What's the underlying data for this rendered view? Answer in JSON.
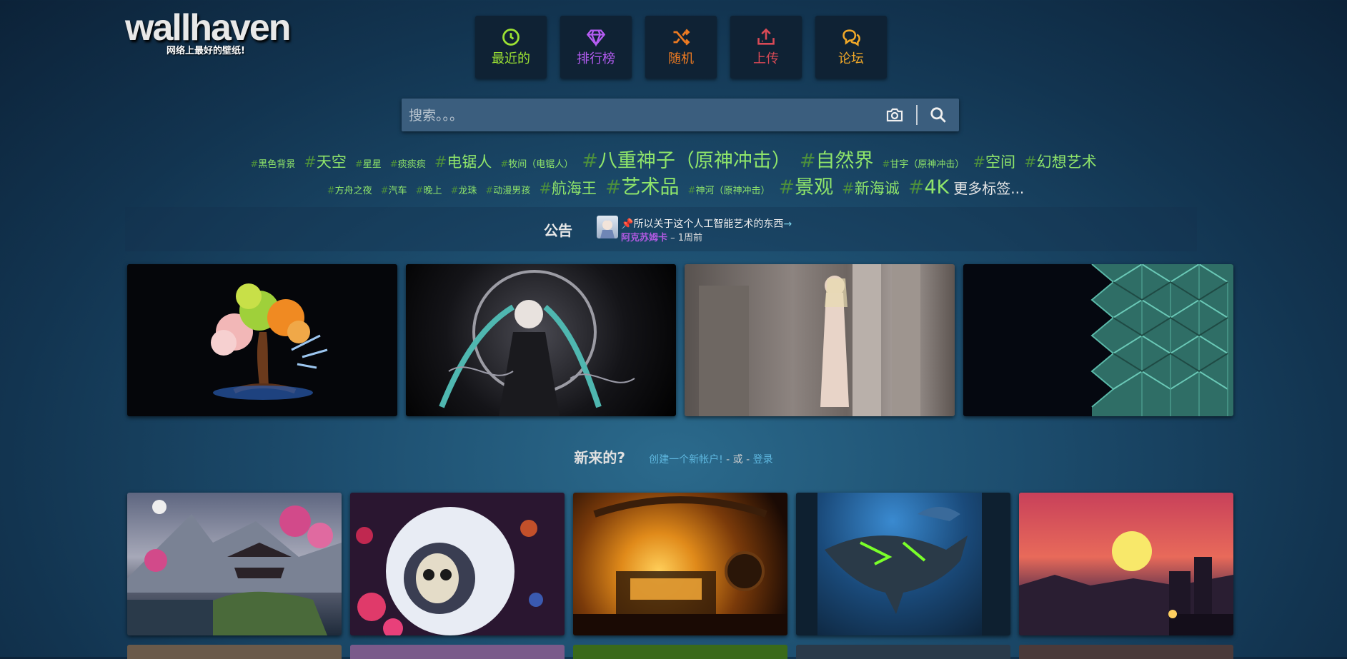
{
  "logo": {
    "title": "wallhaven",
    "subtitle": "网络上最好的壁纸!"
  },
  "nav": [
    {
      "label": "最近的",
      "icon": "clock-icon",
      "color": "#9ce233"
    },
    {
      "label": "排行榜",
      "icon": "diamond-icon",
      "color": "#b45cf2"
    },
    {
      "label": "随机",
      "icon": "shuffle-icon",
      "color": "#ec7a22"
    },
    {
      "label": "上传",
      "icon": "upload-icon",
      "color": "#d94a56"
    },
    {
      "label": "论坛",
      "icon": "chat-icon",
      "color": "#f0a828"
    }
  ],
  "search": {
    "placeholder": "搜索。。。",
    "icons": [
      "camera-icon",
      "search-icon"
    ]
  },
  "tags_row1": [
    {
      "label": "黑色背景",
      "size": "s1"
    },
    {
      "label": "天空",
      "size": "s2"
    },
    {
      "label": "星星",
      "size": "s1"
    },
    {
      "label": "痰痰痰",
      "size": "s1"
    },
    {
      "label": "电锯人",
      "size": "s2"
    },
    {
      "label": "牧间（电锯人）",
      "size": "s1"
    },
    {
      "label": "八重神子（原神冲击）",
      "size": "s3"
    },
    {
      "label": "自然界",
      "size": "s3"
    },
    {
      "label": "甘宇（原神冲击）",
      "size": "s1"
    },
    {
      "label": "空间",
      "size": "s2"
    },
    {
      "label": "幻想艺术",
      "size": "s2"
    }
  ],
  "tags_row2": [
    {
      "label": "方舟之夜",
      "size": "s1"
    },
    {
      "label": "汽车",
      "size": "s1"
    },
    {
      "label": "晚上",
      "size": "s1"
    },
    {
      "label": "龙珠",
      "size": "s1"
    },
    {
      "label": "动漫男孩",
      "size": "s1"
    },
    {
      "label": "航海王",
      "size": "s2"
    },
    {
      "label": "艺术品",
      "size": "s3"
    },
    {
      "label": "神河（原神冲击）",
      "size": "s1"
    },
    {
      "label": "景观",
      "size": "s3"
    },
    {
      "label": "新海诚",
      "size": "s2"
    },
    {
      "label": "4K",
      "size": "s3"
    }
  ],
  "tags_more": "更多标签...",
  "announcement": {
    "label": "公告",
    "pin_icon": "pin-icon",
    "title": "所以关于这个人工智能艺术的东西",
    "user": "阿克苏姆卡",
    "time": "– 1周前"
  },
  "featured": [
    "tree-wallpaper",
    "anime-girl-wallpaper",
    "elf-pillars-wallpaper",
    "hexagon-pattern-wallpaper"
  ],
  "signup": {
    "question": "新来的?",
    "create": "创建一个新帐户!",
    "or": "- 或 -",
    "login": "登录"
  },
  "latest": [
    "pixel-temple-wallpaper",
    "astronaut-skull-wallpaper",
    "forge-wallpaper",
    "shark-wallpaper",
    "sunset-city-wallpaper"
  ]
}
